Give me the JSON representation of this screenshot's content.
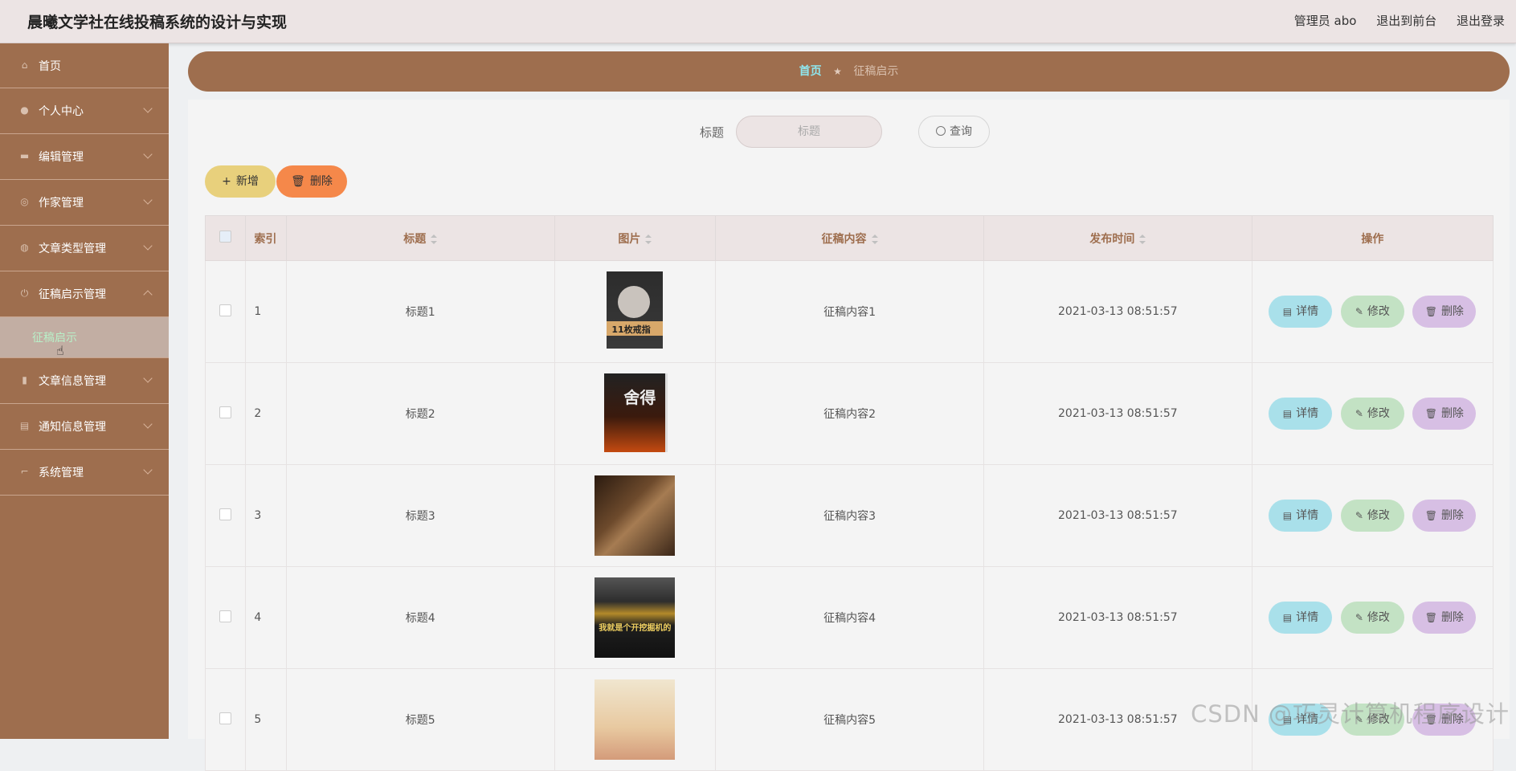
{
  "header": {
    "title": "晨曦文学社在线投稿系统的设计与实现",
    "user": "管理员 abo",
    "to_front": "退出到前台",
    "logout": "退出登录"
  },
  "sidebar": {
    "items": [
      {
        "label": "首页",
        "icon": "home-icon"
      },
      {
        "label": "个人中心",
        "icon": "user-icon"
      },
      {
        "label": "编辑管理",
        "icon": "monitor-icon"
      },
      {
        "label": "作家管理",
        "icon": "globe-icon"
      },
      {
        "label": "文章类型管理",
        "icon": "basketball-icon"
      },
      {
        "label": "征稿启示管理",
        "icon": "power-icon"
      },
      {
        "label": "文章信息管理",
        "icon": "chart-icon"
      },
      {
        "label": "通知信息管理",
        "icon": "clipboard-icon"
      },
      {
        "label": "系统管理",
        "icon": "crop-icon"
      }
    ],
    "submenu_active": "征稿启示"
  },
  "breadcrumb": {
    "home": "首页",
    "current": "征稿启示"
  },
  "search": {
    "label": "标题",
    "placeholder": "标题",
    "button": "查询"
  },
  "actions": {
    "add": "新增",
    "delete": "删除"
  },
  "table": {
    "headers": {
      "index": "索引",
      "title": "标题",
      "image": "图片",
      "content": "征稿内容",
      "time": "发布时间",
      "ops": "操作"
    },
    "rows": [
      {
        "index": "1",
        "title": "标题1",
        "content": "征稿内容1",
        "time": "2021-03-13 08:51:57",
        "image_text": "11枚戒指"
      },
      {
        "index": "2",
        "title": "标题2",
        "content": "征稿内容2",
        "time": "2021-03-13 08:51:57",
        "image_text": "舍得"
      },
      {
        "index": "3",
        "title": "标题3",
        "content": "征稿内容3",
        "time": "2021-03-13 08:51:57",
        "image_text": ""
      },
      {
        "index": "4",
        "title": "标题4",
        "content": "征稿内容4",
        "time": "2021-03-13 08:51:57",
        "image_text": "我就是个开挖掘机的"
      },
      {
        "index": "5",
        "title": "标题5",
        "content": "征稿内容5",
        "time": "2021-03-13 08:51:57",
        "image_text": ""
      }
    ],
    "op_labels": {
      "detail": "详情",
      "edit": "修改",
      "delete": "删除"
    }
  },
  "watermark": "CSDN @巧灵计算机程序设计",
  "colors": {
    "sidebar_bg": "#9e6e4e",
    "header_bg": "#ece4e4",
    "add_button": "#e8d07c",
    "delete_button": "#f5884a",
    "detail_button": "#a9e0ea",
    "edit_button": "#c3e2c4",
    "row_delete_button": "#d7bfe4"
  }
}
